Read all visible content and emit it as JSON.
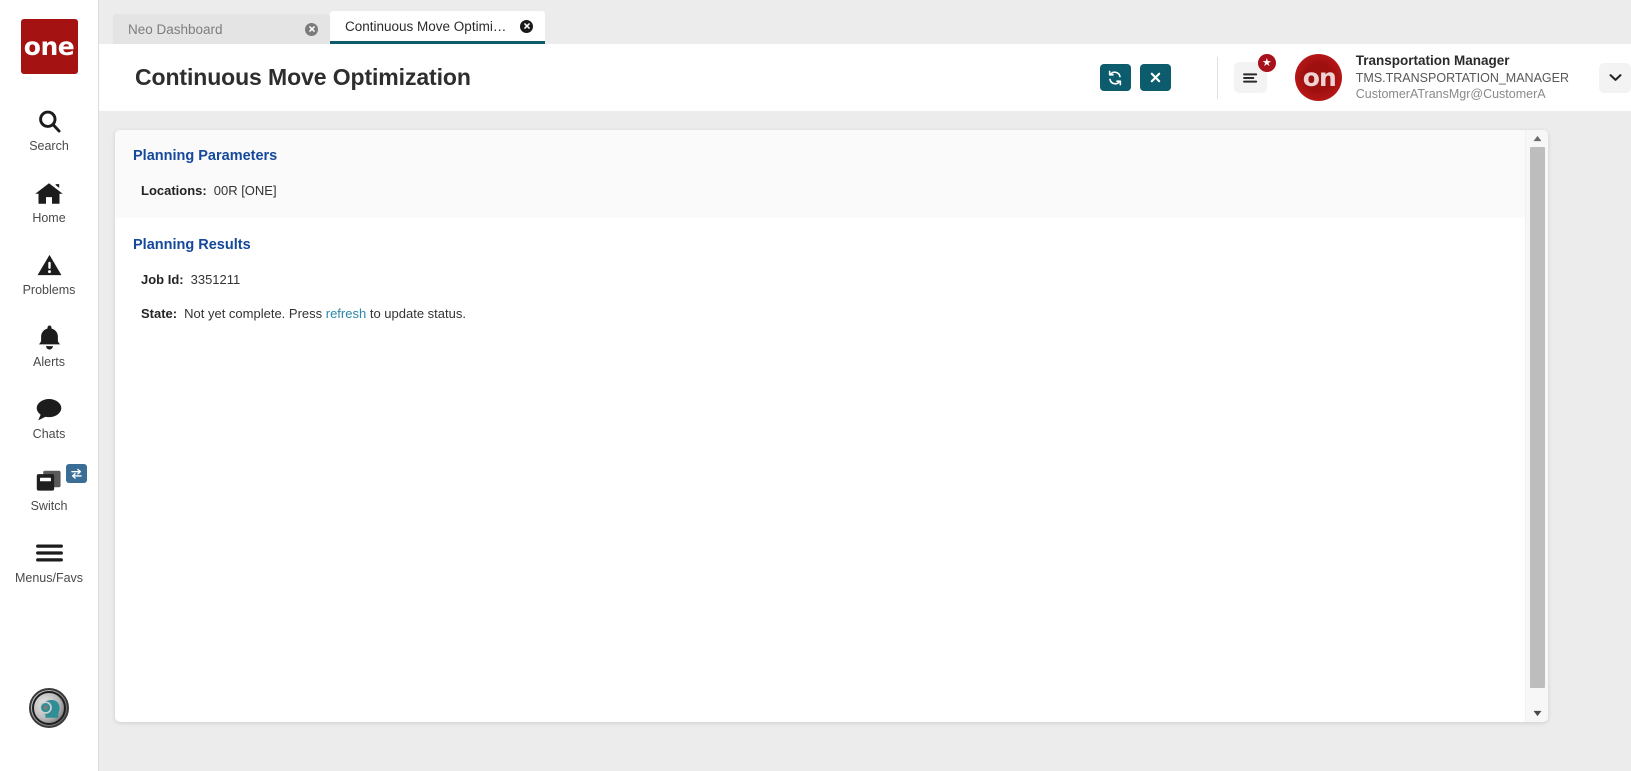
{
  "app": {
    "brand_logo_text": "one"
  },
  "sidebar": {
    "items": [
      {
        "label": "Search",
        "icon": "search-icon"
      },
      {
        "label": "Home",
        "icon": "home-icon"
      },
      {
        "label": "Problems",
        "icon": "warning-triangle-icon"
      },
      {
        "label": "Alerts",
        "icon": "bell-icon"
      },
      {
        "label": "Chats",
        "icon": "chat-bubble-icon"
      },
      {
        "label": "Switch",
        "icon": "windows-stack-icon",
        "badge_icon": "swap-arrows-icon"
      },
      {
        "label": "Menus/Favs",
        "icon": "hamburger-icon"
      }
    ],
    "assistant_icon": "ai-assistant-avatar-icon"
  },
  "tabs": [
    {
      "label": "Neo Dashboard",
      "active": false,
      "close_icon": "close-circle-icon"
    },
    {
      "label": "Continuous Move Optimization",
      "active": true,
      "close_icon": "close-circle-icon"
    }
  ],
  "header": {
    "title": "Continuous Move Optimization",
    "actions": [
      {
        "name": "refresh-button",
        "icon": "refresh-sync-icon",
        "label": "Refresh"
      },
      {
        "name": "close-button",
        "icon": "x-icon",
        "label": "Close"
      }
    ],
    "menu_button": {
      "icon": "list-menu-icon",
      "badge_icon": "star-icon",
      "badge_glyph": "★"
    },
    "user": {
      "avatar_text": "on",
      "role": "Transportation Manager",
      "account": "TMS.TRANSPORTATION_MANAGER",
      "email": "CustomerATransMgr@CustomerA",
      "caret_icon": "chevron-down-icon"
    }
  },
  "main": {
    "planning_parameters": {
      "title": "Planning Parameters",
      "fields": [
        {
          "label": "Locations:",
          "value": "00R [ONE]"
        }
      ]
    },
    "planning_results": {
      "title": "Planning Results",
      "fields": [
        {
          "label": "Job Id:",
          "value": "3351211"
        }
      ],
      "state_label": "State:",
      "state_prefix": "Not yet complete. Press ",
      "state_link": "refresh",
      "state_suffix": " to update status."
    }
  },
  "scrollbar": {
    "up_icon": "scroll-up-arrow-icon",
    "down_icon": "scroll-down-arrow-icon"
  },
  "colors": {
    "brand_red": "#a51212",
    "accent_teal": "#0d5c6e",
    "section_blue": "#14489a",
    "link_teal": "#2b87a8",
    "badge_red": "#a6111b",
    "switch_badge_blue": "#3a6e97"
  }
}
